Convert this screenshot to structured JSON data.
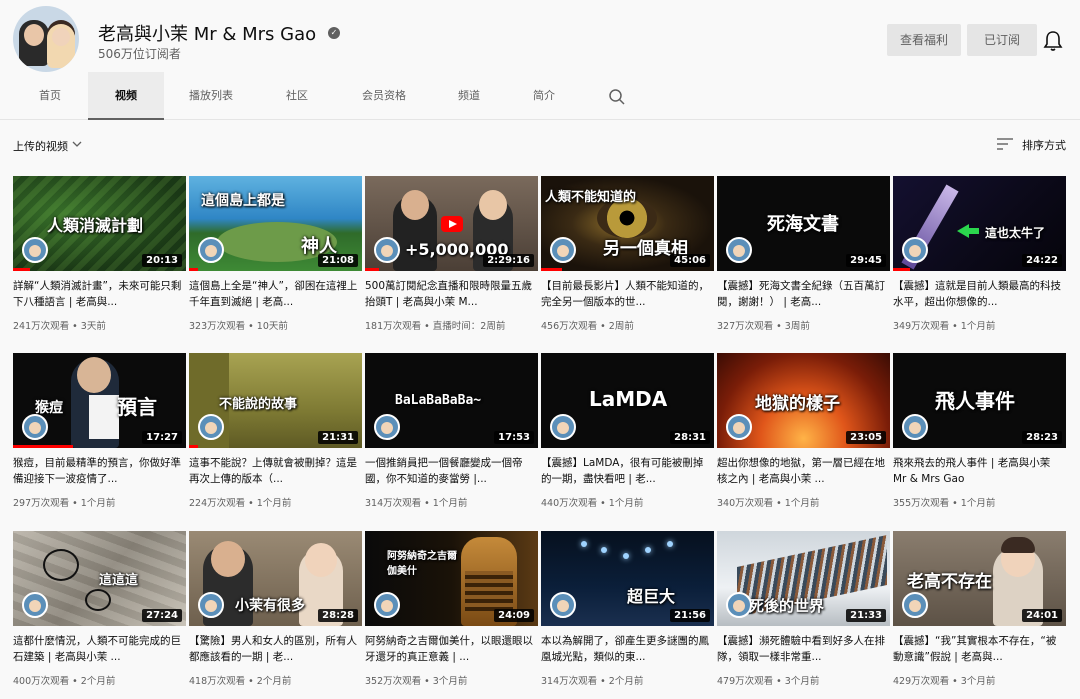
{
  "channel": {
    "name": "老高與小茉 Mr & Mrs Gao",
    "subscribers": "506万位订阅者",
    "perks_label": "查看福利",
    "subscribed_label": "已订阅"
  },
  "tabs": [
    {
      "label": "首页"
    },
    {
      "label": "视频"
    },
    {
      "label": "播放列表"
    },
    {
      "label": "社区"
    },
    {
      "label": "会员资格"
    },
    {
      "label": "频道"
    },
    {
      "label": "简介"
    }
  ],
  "filters": {
    "uploads_label": "上传的视频",
    "sort_label": "排序方式"
  },
  "videos": [
    {
      "title": "詳解“人類消滅計畫”，未來可能只剩下八種語言 | 老高與...",
      "views": "241万次观看",
      "age": "3天前",
      "duration": "20:13",
      "thumb_text": "人類消滅計劃",
      "progress": 0.1
    },
    {
      "title": "這個島上全是“神人”，卻困在這裡上千年直到滅絕 | 老高...",
      "views": "323万次观看",
      "age": "10天前",
      "duration": "21:08",
      "thumb_text_1": "這個島上都是",
      "thumb_text_2": "神人",
      "progress": 0.05
    },
    {
      "title": "500萬訂閱紀念直播和限時限量五歲抬頭T | 老高與小茉 M...",
      "views": "181万次观看",
      "age": "直播时间：2周前",
      "duration": "2:29:16",
      "thumb_text": "+5,000,000",
      "progress": 0.08
    },
    {
      "title": "【目前最長影片】人類不能知道的，完全另一個版本的世...",
      "views": "456万次观看",
      "age": "2周前",
      "duration": "45:06",
      "thumb_text_1": "人類不能知道的",
      "thumb_text_2": "另一個真相",
      "progress": 0.12
    },
    {
      "title": "【震撼】死海文書全紀錄（五百萬訂閱，謝謝！） | 老高...",
      "views": "327万次观看",
      "age": "3周前",
      "duration": "29:45",
      "thumb_text": "死海文書",
      "progress": 0
    },
    {
      "title": "【震撼】這就是目前人類最高的科技水平，超出你想像的...",
      "views": "349万次观看",
      "age": "1个月前",
      "duration": "24:22",
      "thumb_text": "這也太牛了",
      "progress": 0.1
    },
    {
      "title": "猴痘，目前最精準的預言，你做好準備迎接下一波疫情了...",
      "views": "297万次观看",
      "age": "1个月前",
      "duration": "17:27",
      "thumb_text_1": "猴痘",
      "thumb_text_2": "預言",
      "progress": 0.35
    },
    {
      "title": "這事不能說？上傳就會被刪掉？這是再次上傳的版本（...",
      "views": "224万次观看",
      "age": "1个月前",
      "duration": "21:31",
      "thumb_text": "不能說的故事",
      "progress": 0.05
    },
    {
      "title": "一個推銷員把一個餐廳變成一個帝國，你不知道的麥當勞 |...",
      "views": "314万次观看",
      "age": "1个月前",
      "duration": "17:53",
      "thumb_text": "BaLaBaBaBa~",
      "progress": 0
    },
    {
      "title": "【震撼】LaMDA，很有可能被刪掉的一期，盡快看吧 | 老...",
      "views": "440万次观看",
      "age": "1个月前",
      "duration": "28:31",
      "thumb_text": "LaMDA",
      "progress": 0
    },
    {
      "title": "超出你想像的地獄，第一層已經在地核之內 | 老高與小茉 ...",
      "views": "340万次观看",
      "age": "1个月前",
      "duration": "23:05",
      "thumb_text": "地獄的樣子",
      "progress": 0
    },
    {
      "title": "飛來飛去的飛人事件 | 老高與小茉 Mr & Mrs Gao",
      "views": "355万次观看",
      "age": "1个月前",
      "duration": "28:23",
      "thumb_text": "飛人事件",
      "progress": 0
    },
    {
      "title": "這都什麼情況，人類不可能完成的巨石建築 | 老高與小茉 ...",
      "views": "400万次观看",
      "age": "2个月前",
      "duration": "27:24",
      "thumb_text": "這這這",
      "progress": 0
    },
    {
      "title": "【驚險】男人和女人的區別，所有人都應該看的一期 | 老...",
      "views": "418万次观看",
      "age": "2个月前",
      "duration": "28:28",
      "thumb_text": "小茉有很多",
      "progress": 0
    },
    {
      "title": "阿努納奇之吉爾伽美什，以眼還眼以牙還牙的真正意義 | ...",
      "views": "352万次观看",
      "age": "3个月前",
      "duration": "24:09",
      "thumb_text": "阿努納奇之吉爾伽美什",
      "progress": 0
    },
    {
      "title": "本以為解開了，卻產生更多謎團的鳳凰城光點，類似的東...",
      "views": "314万次观看",
      "age": "2个月前",
      "duration": "21:56",
      "thumb_text": "超巨大",
      "progress": 0
    },
    {
      "title": "【震撼】瀕死體驗中看到好多人在排隊，領取一樣非常重...",
      "views": "479万次观看",
      "age": "3个月前",
      "duration": "21:33",
      "thumb_text": "死後的世界",
      "progress": 0
    },
    {
      "title": "【震撼】“我”其實根本不存在，“被動意識”假說 | 老高與...",
      "views": "429万次观看",
      "age": "3个月前",
      "duration": "24:01",
      "thumb_text": "老高不存在",
      "progress": 0
    }
  ],
  "meta_sep": " • "
}
